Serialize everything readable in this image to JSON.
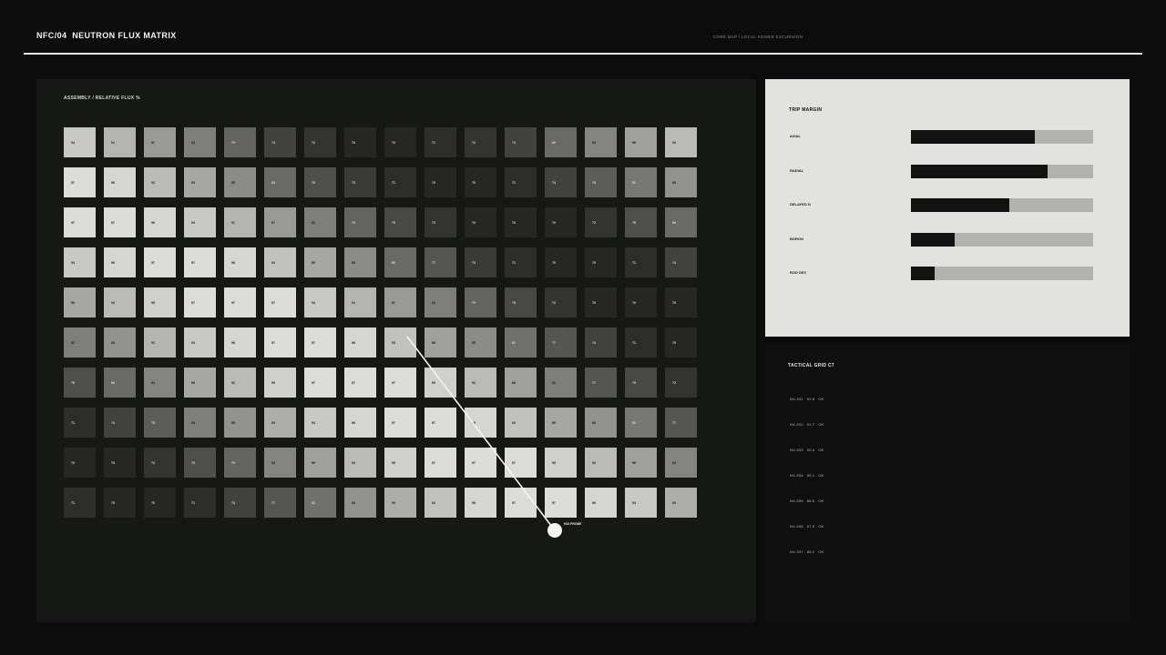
{
  "header": {
    "title": "NFC/04  NEUTRON FLUX MATRIX",
    "subtitle": "CORE MAP / LOCAL POWER EXCURSION"
  },
  "assembly": {
    "title": "ASSEMBLY / RELATIVE FLUX %",
    "rows": [
      [
        94,
        91,
        87,
        83,
        79,
        74,
        72,
        70,
        70,
        71,
        72,
        74,
        80,
        84,
        88,
        92
      ],
      [
        97,
        96,
        92,
        89,
        85,
        80,
        76,
        73,
        71,
        70,
        70,
        71,
        74,
        78,
        82,
        86
      ],
      [
        97,
        97,
        96,
        94,
        91,
        87,
        83,
        79,
        75,
        72,
        70,
        70,
        70,
        72,
        76,
        80
      ],
      [
        94,
        96,
        97,
        97,
        96,
        93,
        89,
        85,
        80,
        77,
        73,
        71,
        70,
        70,
        71,
        74
      ],
      [
        89,
        92,
        95,
        97,
        97,
        97,
        94,
        91,
        87,
        83,
        79,
        75,
        72,
        70,
        70,
        70
      ],
      [
        83,
        86,
        91,
        94,
        96,
        97,
        97,
        96,
        93,
        88,
        85,
        81,
        77,
        74,
        71,
        70
      ],
      [
        76,
        80,
        84,
        89,
        92,
        95,
        97,
        97,
        97,
        95,
        92,
        88,
        83,
        77,
        75,
        72
      ],
      [
        71,
        74,
        78,
        83,
        86,
        90,
        94,
        96,
        97,
        97,
        96,
        93,
        89,
        86,
        82,
        77
      ],
      [
        70,
        70,
        72,
        76,
        79,
        84,
        88,
        92,
        95,
        97,
        97,
        97,
        95,
        92,
        88,
        84
      ],
      [
        71,
        70,
        70,
        71,
        74,
        77,
        81,
        86,
        90,
        93,
        96,
        97,
        97,
        96,
        94,
        90
      ]
    ]
  },
  "probe": {
    "label": "HUI PROBE"
  },
  "trip_margin": {
    "title": "TRIP MARGIN",
    "items": [
      {
        "label": "AXIAL",
        "fraction": 0.68
      },
      {
        "label": "RADIAL",
        "fraction": 0.75
      },
      {
        "label": "DELAYED N",
        "fraction": 0.54
      },
      {
        "label": "BORON",
        "fraction": 0.24
      },
      {
        "label": "ROD DEV",
        "fraction": 0.13
      }
    ]
  },
  "tactical": {
    "title": "TACTICAL GRID C7",
    "rows": [
      {
        "id": "NX-931",
        "value": "92.8",
        "status": "OK"
      },
      {
        "id": "NX-932",
        "value": "91.7",
        "status": "OK"
      },
      {
        "id": "NX-933",
        "value": "90.4",
        "status": "OK"
      },
      {
        "id": "NX-934",
        "value": "89.1",
        "status": "OK"
      },
      {
        "id": "NX-935",
        "value": "88.6",
        "status": "OK"
      },
      {
        "id": "NX-936",
        "value": "87.5",
        "status": "OK"
      },
      {
        "id": "NX-937",
        "value": "86.2",
        "status": "OK"
      }
    ]
  }
}
